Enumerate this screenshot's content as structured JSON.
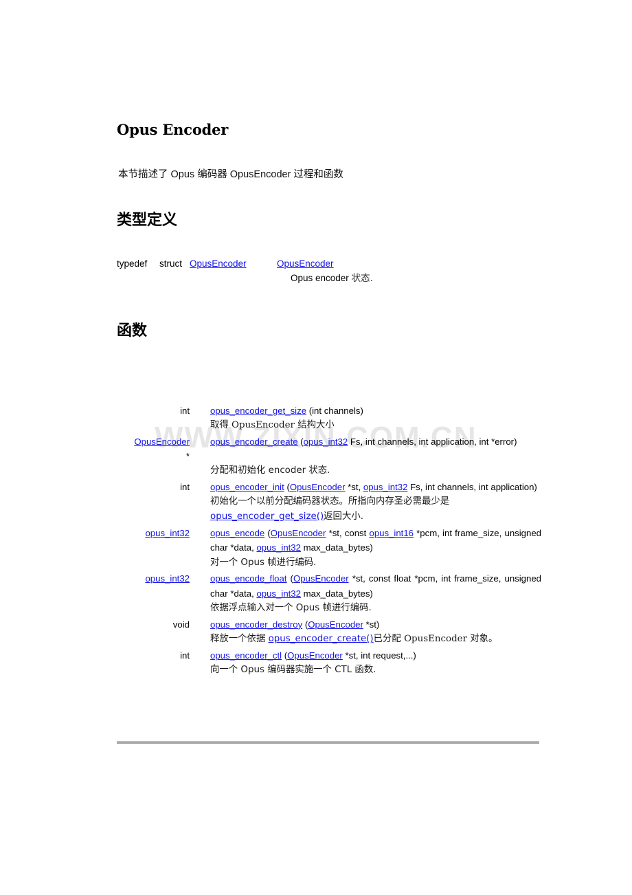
{
  "document": {
    "title": "Opus Encoder",
    "intro": "本节描述了 Opus 编码器 OpusEncoder 过程和函数",
    "watermark": "WWW.ZIXIN.COM.CN",
    "link_color": "#1414e6",
    "rule_color": "#a8a8a8"
  },
  "typedef_section": {
    "heading": "类型定义",
    "row": {
      "keyword": "typedef",
      "keyword2": "struct",
      "struct_name": "OpusEncoder",
      "alias": "OpusEncoder",
      "description_code": "Opus encoder",
      "description_cjk": "状态."
    }
  },
  "functions_section": {
    "heading": "函数",
    "rows": [
      {
        "return_type": "int",
        "name": "opus_encoder_get_size",
        "params_text": " (int channels)",
        "description": "取得 OpusEncoder 结构大小",
        "desc_pre": "取得 ",
        "desc_code": "OpusEncoder",
        "desc_post": " 结构大小"
      },
      {
        "return_type": "OpusEncoder *",
        "return_type_line1": "OpusEncoder",
        "return_type_line2": "*",
        "name": "opus_encoder_create",
        "params_text": " (opus_int32 Fs, int channels, int application, int *error)",
        "param_link": "opus_int32",
        "description": "分配和初始化 encoder 状态."
      },
      {
        "return_type": "int",
        "name": "opus_encoder_init",
        "params_text": " (OpusEncoder *st, opus_int32 Fs, int channels, int application)",
        "description_line1": "初始化一个以前分配编码器状态。所指向内存圣必需最少是",
        "description_link": "opus_encoder_get_size()",
        "description_line2_tail": "返回大小."
      },
      {
        "return_type": "opus_int32",
        "name": "opus_encode",
        "params_text": " (OpusEncoder *st, const opus_int16 *pcm, int frame_size, unsigned char *data, opus_int32 max_data_bytes)",
        "description": "对一个 Opus 帧进行编码."
      },
      {
        "return_type": "opus_int32",
        "name": "opus_encode_float",
        "params_text": " (OpusEncoder *st, const float *pcm, int frame_size, unsigned char *data, opus_int32 max_data_bytes)",
        "description": "依据浮点输入对一个 Opus 帧进行编码."
      },
      {
        "return_type": "void",
        "name": "opus_encoder_destroy",
        "params_text": " (OpusEncoder *st)",
        "description_pre": "释放一个依据 ",
        "description_link": "opus_encoder_create()",
        "description_mid": "已分配 ",
        "description_code": "OpusEncoder",
        "description_post": " 对象。"
      },
      {
        "return_type": "int",
        "name": "opus_encoder_ctl",
        "params_text": " (OpusEncoder *st, int request,...)",
        "description": "向一个 Opus 编码器实施一个 CTL 函数."
      }
    ],
    "tokens": {
      "opus_encoder": "OpusEncoder",
      "opus_int32": "opus_int32",
      "opus_int16": "opus_int16",
      "st_const": "*st, const ",
      "st": "*st",
      "st_comma": "*st, ",
      "open_paren": " (",
      "close_paren": ")",
      "fs_channels_app": " Fs, int channels, int application, int",
      "error_line": "*error)",
      "init_tail": " Fs, int channels, int",
      "init_line2": "application)",
      "pcm_int16_tail": " *pcm, int frame_size,",
      "encode_line2_pre": "unsigned char *data, ",
      "encode_line2_post": " max_data_bytes)",
      "float_pcm_tail": "*st, const float *pcm, int frame_size,",
      "ctl_tail": "*st, int request,...)",
      "destroy_tail": "*st)"
    }
  }
}
